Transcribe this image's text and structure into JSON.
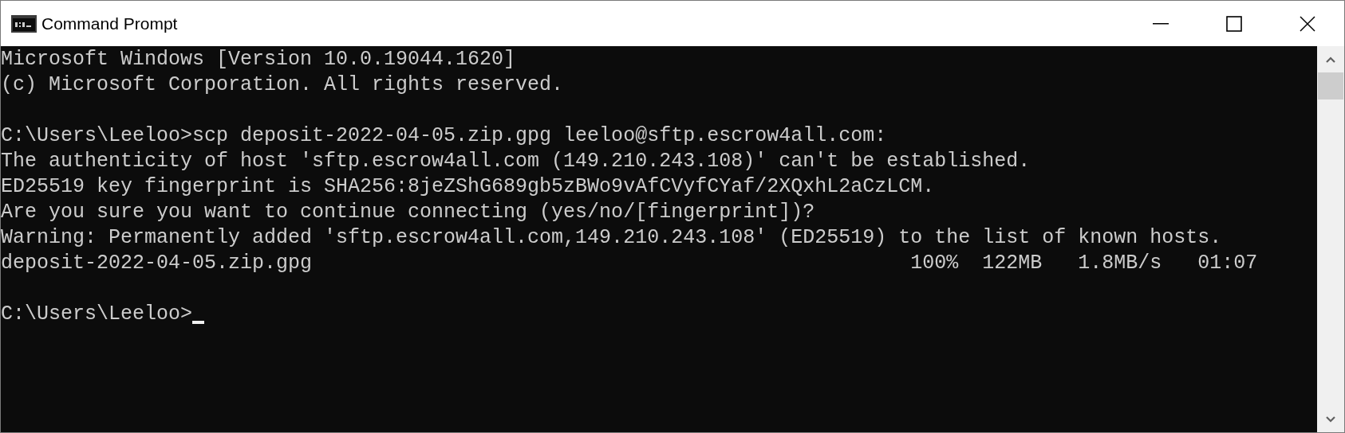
{
  "window": {
    "title": "Command Prompt"
  },
  "terminal": {
    "blocks": [
      [
        "Microsoft Windows [Version 10.0.19044.1620]",
        "(c) Microsoft Corporation. All rights reserved."
      ],
      [
        "C:\\Users\\Leeloo>scp deposit-2022-04-05.zip.gpg leeloo@sftp.escrow4all.com:",
        "The authenticity of host 'sftp.escrow4all.com (149.210.243.108)' can't be established.",
        "ED25519 key fingerprint is SHA256:8jeZShG689gb5zBWo9vAfCVyfCYaf/2XQxhL2aCzLCM.",
        "Are you sure you want to continue connecting (yes/no/[fingerprint])?",
        "Warning: Permanently added 'sftp.escrow4all.com,149.210.243.108' (ED25519) to the list of known hosts.",
        "deposit-2022-04-05.zip.gpg                                                  100%  122MB   1.8MB/s   01:07"
      ],
      [
        "C:\\Users\\Leeloo>"
      ]
    ]
  }
}
